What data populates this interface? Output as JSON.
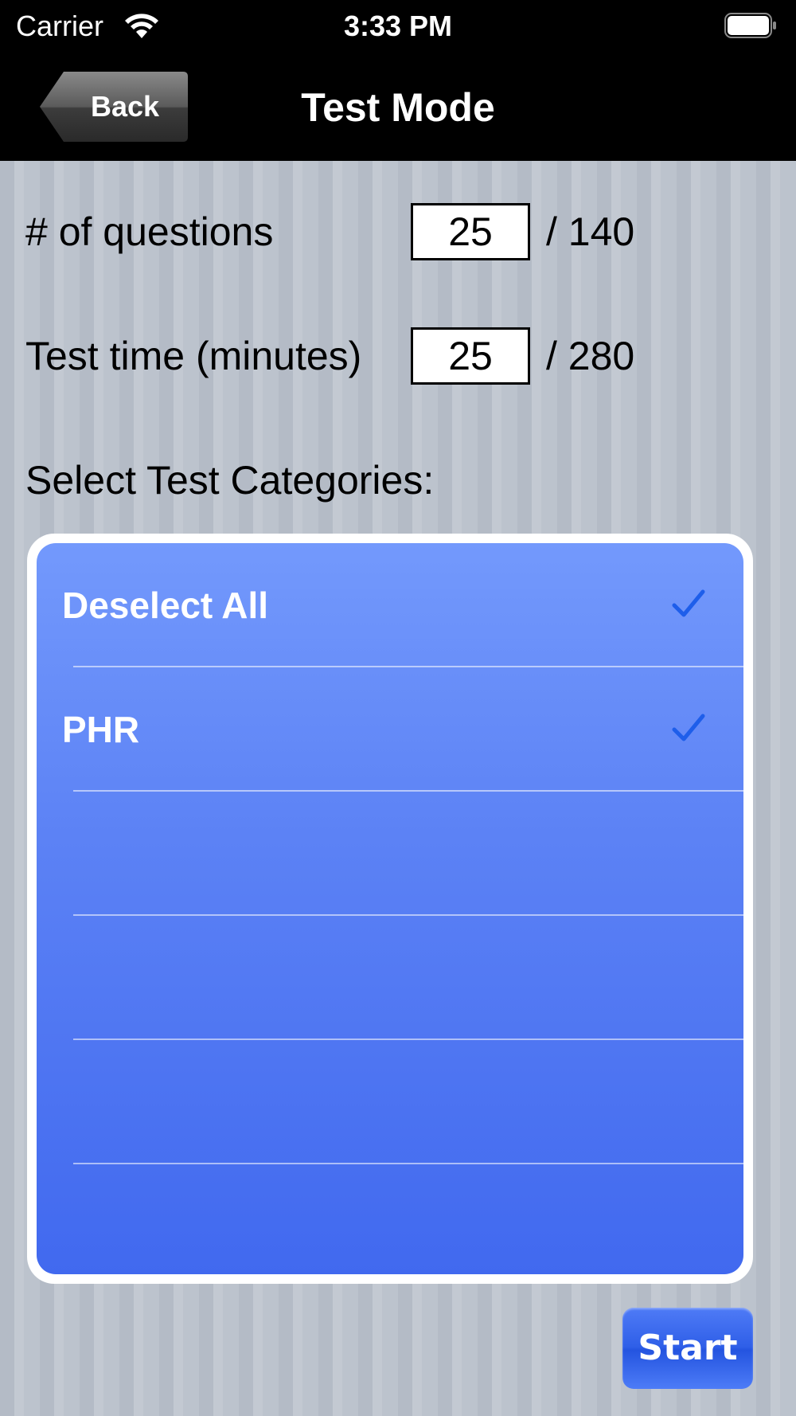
{
  "status_bar": {
    "carrier": "Carrier",
    "time": "3:33 PM",
    "wifi_icon": "wifi-icon",
    "battery_icon": "battery-icon"
  },
  "nav_bar": {
    "back_label": "Back",
    "title": "Test Mode"
  },
  "settings": {
    "questions_label": "# of questions",
    "questions_value": "25",
    "questions_max": "/ 140",
    "time_label": "Test time (minutes)",
    "time_value": "25",
    "time_max": "/ 280"
  },
  "categories": {
    "header": "Select Test Categories:",
    "items": [
      {
        "label": "Deselect All",
        "checked": true
      },
      {
        "label": "PHR",
        "checked": true
      },
      {
        "label": "",
        "checked": false
      },
      {
        "label": "",
        "checked": false
      },
      {
        "label": "",
        "checked": false
      },
      {
        "label": "",
        "checked": false
      }
    ],
    "check_color": "#1e5eea",
    "list_gradient_top": "#7399fc",
    "list_gradient_bottom": "#4169ef"
  },
  "start_button": {
    "label": "Start"
  }
}
